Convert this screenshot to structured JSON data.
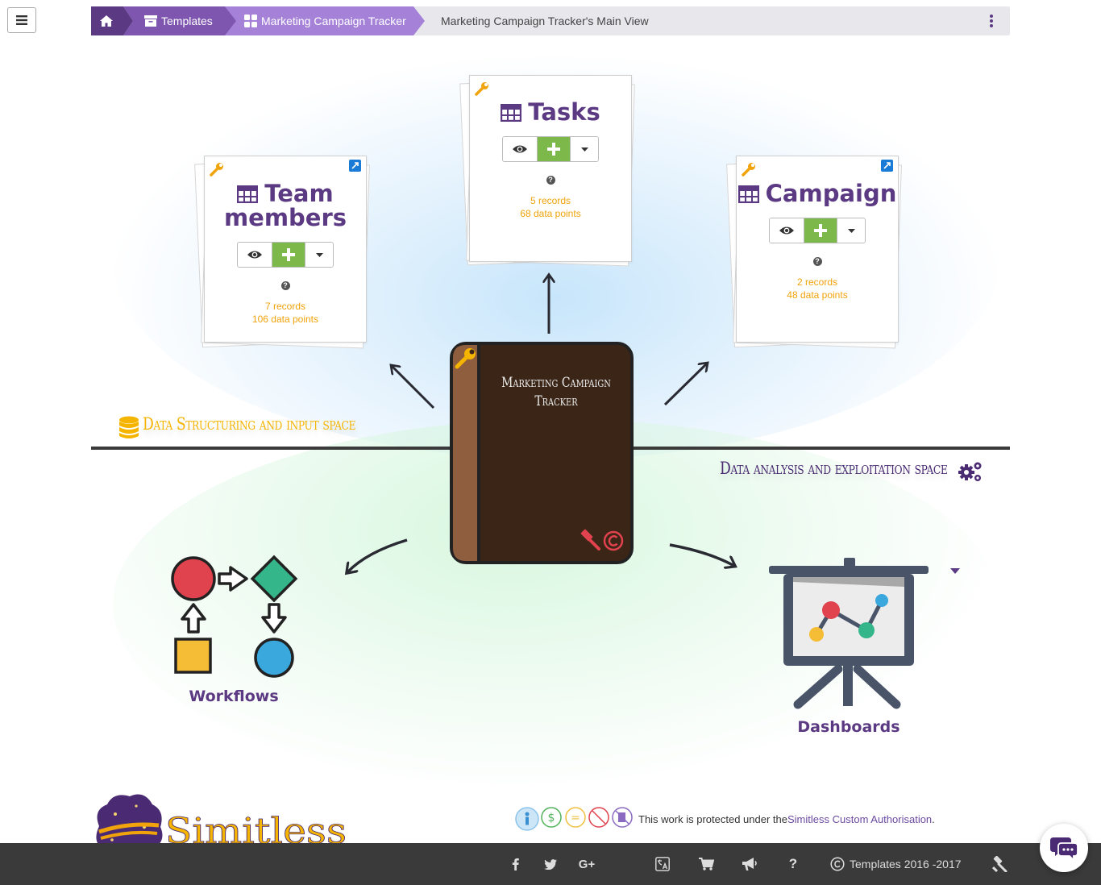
{
  "breadcrumb": {
    "home_label": "",
    "templates_label": "Templates",
    "tracker_label": "Marketing Campaign Tracker",
    "current_label": "Marketing Campaign Tracker's Main View"
  },
  "cards": {
    "tasks": {
      "title": "Tasks",
      "records": "5 records",
      "points": "68 data points"
    },
    "team": {
      "title_line1": "Team",
      "title_line2": "members",
      "records": "7 records",
      "points": "106 data points"
    },
    "campaign": {
      "title": "Campaign",
      "records": "2 records",
      "points": "48 data points"
    }
  },
  "book": {
    "title_line1": "Marketing Campaign",
    "title_line2": "Tracker"
  },
  "spaces": {
    "input": "Data Structuring and input space",
    "analysis": "Data analysis and exploitation space"
  },
  "sections": {
    "workflows": "Workflows",
    "dashboards": "Dashboards"
  },
  "brand": {
    "name": "Simitless"
  },
  "license": {
    "prefix": "This work is protected under the ",
    "link": "Simitless Custom Authorisation",
    "suffix": "."
  },
  "footer": {
    "copyright": "Templates 2016 -2017"
  },
  "colors": {
    "purple": "#5b3a83",
    "orange": "#f0a30a",
    "green": "#7cb84a",
    "footer": "#3a3a3a"
  }
}
